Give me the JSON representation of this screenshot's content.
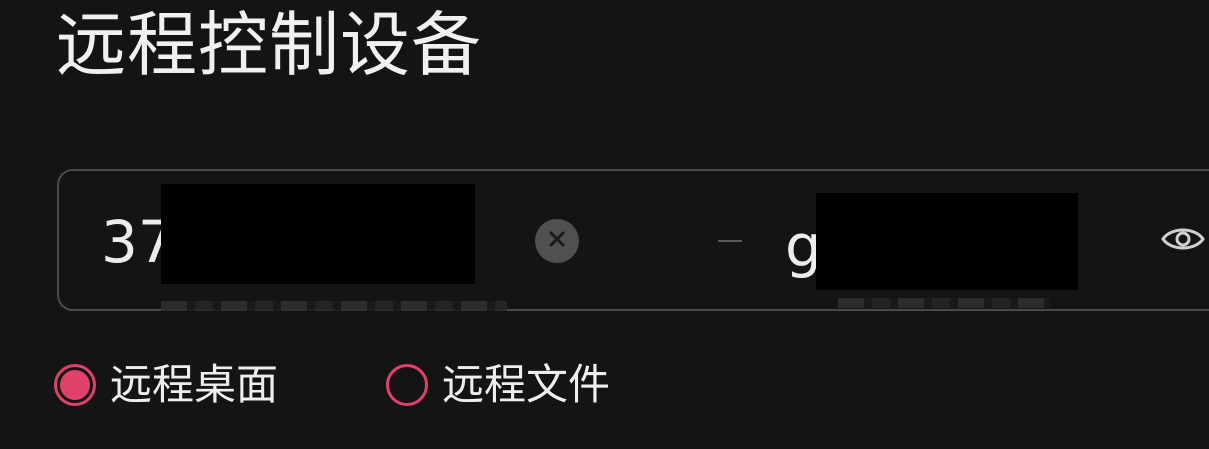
{
  "page": {
    "title": "远程控制设备"
  },
  "connection": {
    "device_id_prefix": "37",
    "password_prefix": "g",
    "separator": "-"
  },
  "icons": {
    "clear": "clear-circle-icon",
    "toggle_visibility": "eye-icon"
  },
  "mode": {
    "options": [
      {
        "label": "远程桌面",
        "selected": true
      },
      {
        "label": "远程文件",
        "selected": false
      }
    ]
  },
  "colors": {
    "background": "#141414",
    "accent": "#e0416a",
    "border": "#4a4a4a",
    "text": "#ececec"
  }
}
